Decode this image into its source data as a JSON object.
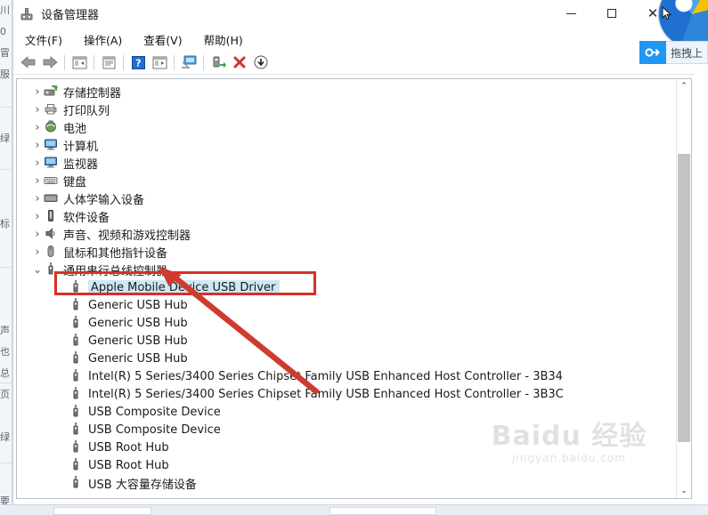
{
  "window": {
    "title": "设备管理器",
    "icon": "device-manager-icon",
    "controls": {
      "minimize": "—",
      "maximize": "□",
      "close": "✕"
    }
  },
  "menu": {
    "items": [
      {
        "label": "文件(F)",
        "name": "menu-file"
      },
      {
        "label": "操作(A)",
        "name": "menu-action"
      },
      {
        "label": "查看(V)",
        "name": "menu-view"
      },
      {
        "label": "帮助(H)",
        "name": "menu-help"
      }
    ]
  },
  "toolbar": {
    "buttons": [
      {
        "name": "back-icon",
        "title": "后退"
      },
      {
        "name": "forward-icon",
        "title": "前进"
      },
      {
        "name": "show-hide-console-tree-icon",
        "title": "显示/隐藏控制台树"
      },
      {
        "name": "properties-icon",
        "title": "属性"
      },
      {
        "name": "help-icon",
        "title": "帮助"
      },
      {
        "name": "show-hide-action-pane-icon",
        "title": "显示/隐藏操作窗格"
      },
      {
        "name": "scan-hardware-changes-icon",
        "title": "扫描检测硬件改动"
      },
      {
        "name": "update-driver-icon",
        "title": "更新驱动程序"
      },
      {
        "name": "uninstall-device-icon",
        "title": "卸载设备"
      },
      {
        "name": "disable-device-icon",
        "title": "禁用设备"
      }
    ]
  },
  "tree": {
    "items": [
      {
        "label": "存储控制器",
        "level": 1,
        "expanded": false,
        "icon": "storage-controller-icon",
        "selected": false
      },
      {
        "label": "打印队列",
        "level": 1,
        "expanded": false,
        "icon": "print-queue-icon",
        "selected": false
      },
      {
        "label": "电池",
        "level": 1,
        "expanded": false,
        "icon": "battery-icon",
        "selected": false
      },
      {
        "label": "计算机",
        "level": 1,
        "expanded": false,
        "icon": "computer-icon",
        "selected": false
      },
      {
        "label": "监视器",
        "level": 1,
        "expanded": false,
        "icon": "monitor-icon",
        "selected": false
      },
      {
        "label": "键盘",
        "level": 1,
        "expanded": false,
        "icon": "keyboard-icon",
        "selected": false
      },
      {
        "label": "人体学输入设备",
        "level": 1,
        "expanded": false,
        "icon": "hid-icon",
        "selected": false
      },
      {
        "label": "软件设备",
        "level": 1,
        "expanded": false,
        "icon": "software-device-icon",
        "selected": false
      },
      {
        "label": "声音、视频和游戏控制器",
        "level": 1,
        "expanded": false,
        "icon": "sound-video-game-icon",
        "selected": false
      },
      {
        "label": "鼠标和其他指针设备",
        "level": 1,
        "expanded": false,
        "icon": "mouse-icon",
        "selected": false
      },
      {
        "label": "通用串行总线控制器",
        "level": 1,
        "expanded": true,
        "icon": "usb-controller-icon",
        "selected": false
      },
      {
        "label": "Apple Mobile Device USB Driver",
        "level": 2,
        "expanded": null,
        "icon": "usb-device-icon",
        "selected": true
      },
      {
        "label": "Generic USB Hub",
        "level": 2,
        "expanded": null,
        "icon": "usb-device-icon",
        "selected": false
      },
      {
        "label": "Generic USB Hub",
        "level": 2,
        "expanded": null,
        "icon": "usb-device-icon",
        "selected": false
      },
      {
        "label": "Generic USB Hub",
        "level": 2,
        "expanded": null,
        "icon": "usb-device-icon",
        "selected": false
      },
      {
        "label": "Generic USB Hub",
        "level": 2,
        "expanded": null,
        "icon": "usb-device-icon",
        "selected": false
      },
      {
        "label": "Intel(R) 5 Series/3400 Series Chipset Family USB Enhanced Host Controller - 3B34",
        "level": 2,
        "expanded": null,
        "icon": "usb-device-icon",
        "selected": false
      },
      {
        "label": "Intel(R) 5 Series/3400 Series Chipset Family USB Enhanced Host Controller - 3B3C",
        "level": 2,
        "expanded": null,
        "icon": "usb-device-icon",
        "selected": false
      },
      {
        "label": "USB Composite Device",
        "level": 2,
        "expanded": null,
        "icon": "usb-device-icon",
        "selected": false
      },
      {
        "label": "USB Composite Device",
        "level": 2,
        "expanded": null,
        "icon": "usb-device-icon",
        "selected": false
      },
      {
        "label": "USB Root Hub",
        "level": 2,
        "expanded": null,
        "icon": "usb-device-icon",
        "selected": false
      },
      {
        "label": "USB Root Hub",
        "level": 2,
        "expanded": null,
        "icon": "usb-device-icon",
        "selected": false
      },
      {
        "label": "USB 大容量存储设备",
        "level": 2,
        "expanded": null,
        "icon": "usb-device-icon",
        "selected": false
      }
    ]
  },
  "annotation": {
    "highlight_color": "#d93025",
    "arrow_color": "#d0342c",
    "target_label": "Apple Mobile Device USB Driver"
  },
  "selection_color": "#cde8f7",
  "scrollbar": {
    "up_glyph": "⌃",
    "down_glyph": "⌄"
  },
  "overlay": {
    "drag_tip": "拖拽上",
    "drag_icon": "link-chain-icon",
    "cursor": "cursor-arrow-icon"
  },
  "watermark": {
    "main": "Baidu 经验",
    "sub": "jingyan.baidu.com"
  },
  "backdrop": {
    "glyphs": [
      "川",
      "0",
      "冒",
      "服",
      "",
      "",
      "绿",
      "",
      "",
      "",
      "标",
      "",
      "",
      "",
      "",
      "声",
      "也",
      "总",
      "页",
      "",
      "绿",
      "",
      "",
      "要"
    ]
  }
}
